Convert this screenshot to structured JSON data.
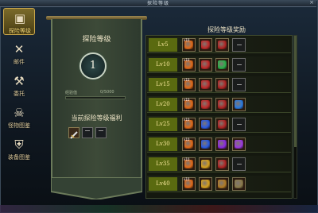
{
  "window": {
    "title": "探险等级"
  },
  "sidenav": {
    "items": [
      {
        "label": "探险等级",
        "icon": "map-icon",
        "selected": true
      },
      {
        "label": "邮件",
        "icon": "crossed-axes-icon",
        "selected": false
      },
      {
        "label": "委托",
        "icon": "hammer-icon",
        "selected": false
      },
      {
        "label": "怪物图鉴",
        "icon": "monster-icon",
        "selected": false
      },
      {
        "label": "装备图鉴",
        "icon": "armor-icon",
        "selected": false
      }
    ]
  },
  "banner": {
    "title": "探险等级",
    "level": "1",
    "exp_label": "经验值",
    "exp_value": "0/5000",
    "exp_fraction": 0.0,
    "welfare_title": "当前探险等级福利"
  },
  "rewards": {
    "header": "探险等级奖励",
    "rows": [
      {
        "level": "Lv5",
        "items": [
          {
            "count": "x10",
            "color": "#e06a1a"
          },
          {
            "count": "",
            "color": "#c02a2a"
          },
          {
            "count": "",
            "color": "#b02424"
          },
          {
            "count": "",
            "color": ""
          }
        ]
      },
      {
        "level": "Lv10",
        "items": [
          {
            "count": "x10",
            "color": "#e06a1a"
          },
          {
            "count": "",
            "color": "#c02a2a"
          },
          {
            "count": "",
            "color": "#2ab04a"
          },
          {
            "count": "",
            "color": ""
          }
        ]
      },
      {
        "level": "Lv15",
        "items": [
          {
            "count": "x10",
            "color": "#e06a1a"
          },
          {
            "count": "",
            "color": "#c02a2a"
          },
          {
            "count": "",
            "color": "#b02424"
          },
          {
            "count": "",
            "color": ""
          }
        ]
      },
      {
        "level": "Lv20",
        "items": [
          {
            "count": "x10",
            "color": "#e06a1a"
          },
          {
            "count": "",
            "color": "#c02a2a"
          },
          {
            "count": "",
            "color": "#b02424"
          },
          {
            "count": "",
            "color": "#2a7ae0"
          }
        ]
      },
      {
        "level": "Lv25",
        "items": [
          {
            "count": "x10",
            "color": "#e06a1a"
          },
          {
            "count": "",
            "color": "#2a5ae0"
          },
          {
            "count": "",
            "color": "#b02424"
          },
          {
            "count": "",
            "color": ""
          }
        ]
      },
      {
        "level": "Lv30",
        "items": [
          {
            "count": "x10",
            "color": "#e06a1a"
          },
          {
            "count": "",
            "color": "#2a5ae0"
          },
          {
            "count": "",
            "color": "#8a2ae0"
          },
          {
            "count": "",
            "color": "#9a3ae0"
          }
        ]
      },
      {
        "level": "Lv35",
        "items": [
          {
            "count": "x10",
            "color": "#e06a1a"
          },
          {
            "count": "",
            "color": "#d4a020"
          },
          {
            "count": "",
            "color": "#b02424"
          },
          {
            "count": "",
            "color": ""
          }
        ]
      },
      {
        "level": "Lv40",
        "items": [
          {
            "count": "x10",
            "color": "#e06a1a"
          },
          {
            "count": "",
            "color": "#d4a020"
          },
          {
            "count": "",
            "color": "#b07a24"
          },
          {
            "count": "",
            "color": "#8a7a4a"
          }
        ]
      }
    ]
  }
}
